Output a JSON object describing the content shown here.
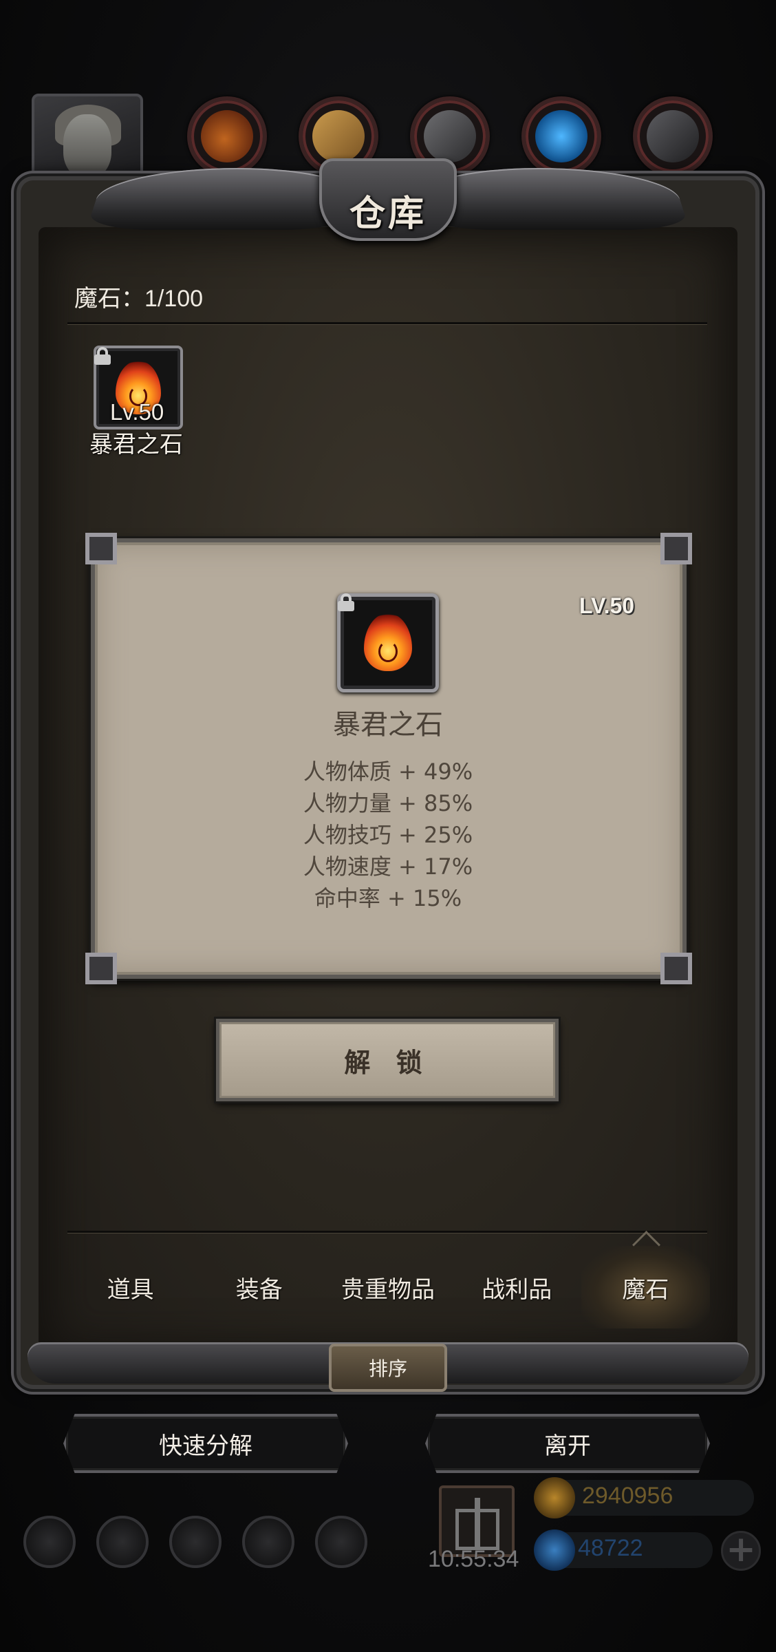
{
  "header": {
    "title": "仓库"
  },
  "category": {
    "count_label": "魔石：1/100"
  },
  "item_slot": {
    "level": "Lv.50",
    "name": "暴君之石",
    "icon": "flame-stone-icon",
    "locked": true
  },
  "detail": {
    "level": "LV.50",
    "name": "暴君之石",
    "icon": "flame-stone-icon",
    "stats": [
      "人物体质 + 49%",
      "人物力量 + 85%",
      "人物技巧 + 25%",
      "人物速度 + 17%",
      "命中率 + 15%"
    ]
  },
  "unlock_button": "解 锁",
  "tabs": {
    "items": [
      "道具",
      "装备",
      "贵重物品",
      "战利品",
      "魔石"
    ],
    "active": "魔石"
  },
  "sort_button": "排序",
  "actions": {
    "quick_decompose": "快速分解",
    "leave": "离开"
  },
  "hud": {
    "time": "10:55:34",
    "gold": "2940956",
    "gems": "48722"
  },
  "colors": {
    "card_bg": "#b5ab9c",
    "panel_bg": "#2a261f",
    "text_light": "#efe9df",
    "text_dark": "#4f463c"
  }
}
